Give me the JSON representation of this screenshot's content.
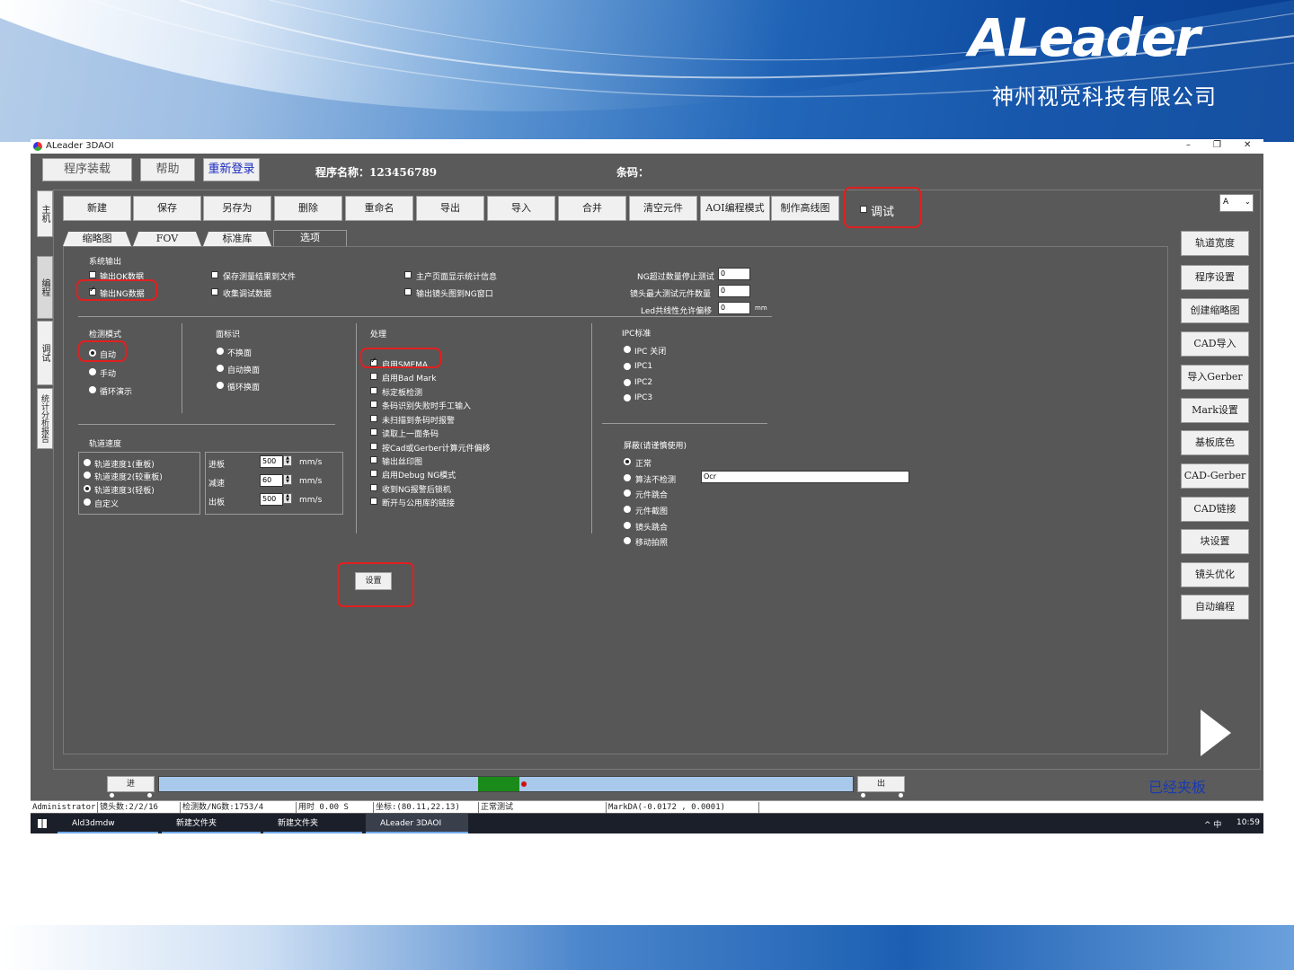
{
  "branding": {
    "logo_text": "ALeader",
    "company": "神州视觉科技有限公司"
  },
  "window": {
    "title": "ALeader 3DAOI",
    "minimize": "–",
    "restore": "❐",
    "close": "✕"
  },
  "toolbar1": {
    "load_program": "程序装载",
    "help": "帮助",
    "relogin": "重新登录",
    "program_name_label": "程序名称：123456789",
    "barcode_label": "条码："
  },
  "toolbar2": {
    "buttons": [
      "新建",
      "保存",
      "另存为",
      "删除",
      "重命名",
      "导出",
      "导入",
      "合并",
      "清空元件",
      "AOI编程模式",
      "制作高线图"
    ],
    "debug_label": "调试",
    "dropdown_value": "A"
  },
  "side_tabs": [
    "主机",
    "编程",
    "调试",
    "统计分析报告"
  ],
  "sub_tabs": [
    "缩略图",
    "FOV",
    "标准库",
    "选项"
  ],
  "system_output": {
    "title": "系统输出",
    "items": [
      {
        "label": "输出OK数据",
        "checked": false
      },
      {
        "label": "输出NG数据",
        "checked": true
      },
      {
        "label": "保存测量结果到文件",
        "checked": false
      },
      {
        "label": "收集调试数据",
        "checked": false
      },
      {
        "label": "主产页面显示统计信息",
        "checked": false
      },
      {
        "label": "输出镜头图到NG窗口",
        "checked": false
      }
    ],
    "ng_stop_label": "NG超过数量停止测试",
    "ng_stop_value": "0",
    "max_components_label": "镜头最大测试元件数量",
    "max_components_value": "0",
    "led_offset_label": "Led共线性允许偏移",
    "led_offset_value": "0",
    "led_offset_unit": "mm"
  },
  "detect_mode": {
    "title": "检测模式",
    "options": [
      "自动",
      "手动",
      "循环演示"
    ],
    "selected": 0
  },
  "face_id": {
    "title": "面标识",
    "options": [
      "不换面",
      "自动换面",
      "循环换面"
    ]
  },
  "processing": {
    "title": "处理",
    "items": [
      {
        "label": "启用SMEMA",
        "checked": true
      },
      {
        "label": "启用Bad Mark",
        "checked": false
      },
      {
        "label": "标定板检测",
        "checked": false
      },
      {
        "label": "条码识别失败时手工输入",
        "checked": false
      },
      {
        "label": "未扫描到条码时报警",
        "checked": false
      },
      {
        "label": "读取上一面条码",
        "checked": false
      },
      {
        "label": "按Cad或Gerber计算元件偏移",
        "checked": false
      },
      {
        "label": "输出丝印图",
        "checked": false
      },
      {
        "label": "启用Debug NG模式",
        "checked": false
      },
      {
        "label": "收到NG报警后锁机",
        "checked": false
      },
      {
        "label": "断开与公用库的链接",
        "checked": false
      }
    ]
  },
  "ipc": {
    "title": "IPC标准",
    "options": [
      "IPC 关闭",
      "IPC1",
      "IPC2",
      "IPC3"
    ]
  },
  "track_speed": {
    "title": "轨道速度",
    "options": [
      "轨道速度1(重板)",
      "轨道速度2(较重板)",
      "轨道速度3(轻板)",
      "自定义"
    ],
    "selected": 2,
    "rows": [
      {
        "label": "进板",
        "value": "500",
        "unit": "mm/s"
      },
      {
        "label": "减速",
        "value": "60",
        "unit": "mm/s"
      },
      {
        "label": "出板",
        "value": "500",
        "unit": "mm/s"
      }
    ]
  },
  "mask": {
    "title": "屏蔽(请谨慎使用)",
    "options": [
      "正常",
      "算法不检测",
      "元件跳合",
      "元件截图",
      "镜头跳合",
      "移动拍照"
    ],
    "selected": 0,
    "ocr_value": "Ocr"
  },
  "settings_button": "设置",
  "right_buttons": [
    "轨道宽度",
    "程序设置",
    "创建缩略图",
    "CAD导入",
    "导入Gerber",
    "Mark设置",
    "基板底色",
    "CAD-Gerber",
    "CAD链接",
    "块设置",
    "镜头优化",
    "自动编程"
  ],
  "conveyor": {
    "in_label": "进",
    "out_label": "出",
    "status": "已经夹板",
    "board_fraction_start": 0.46,
    "board_fraction_end": 0.52
  },
  "statusbar": [
    "Administrator",
    "镜头数:2/2/16",
    "检测数/NG数:1753/4",
    "用时 0.00 S",
    "坐标:(80.11,22.13)",
    "正常测试",
    "MarkDA(-0.0172 , 0.0001)"
  ],
  "taskbar": {
    "items": [
      "Ald3dmdw",
      "新建文件夹",
      "新建文件夹",
      "ALeader 3DAOI"
    ],
    "tray": "^  中",
    "time": "10:59"
  },
  "colors": {
    "panel": "#575757",
    "highlight_red": "#e02020",
    "board_green": "#1a8a1a",
    "track_blue": "#a8c8ec",
    "status_blue": "#1a3ab0"
  }
}
